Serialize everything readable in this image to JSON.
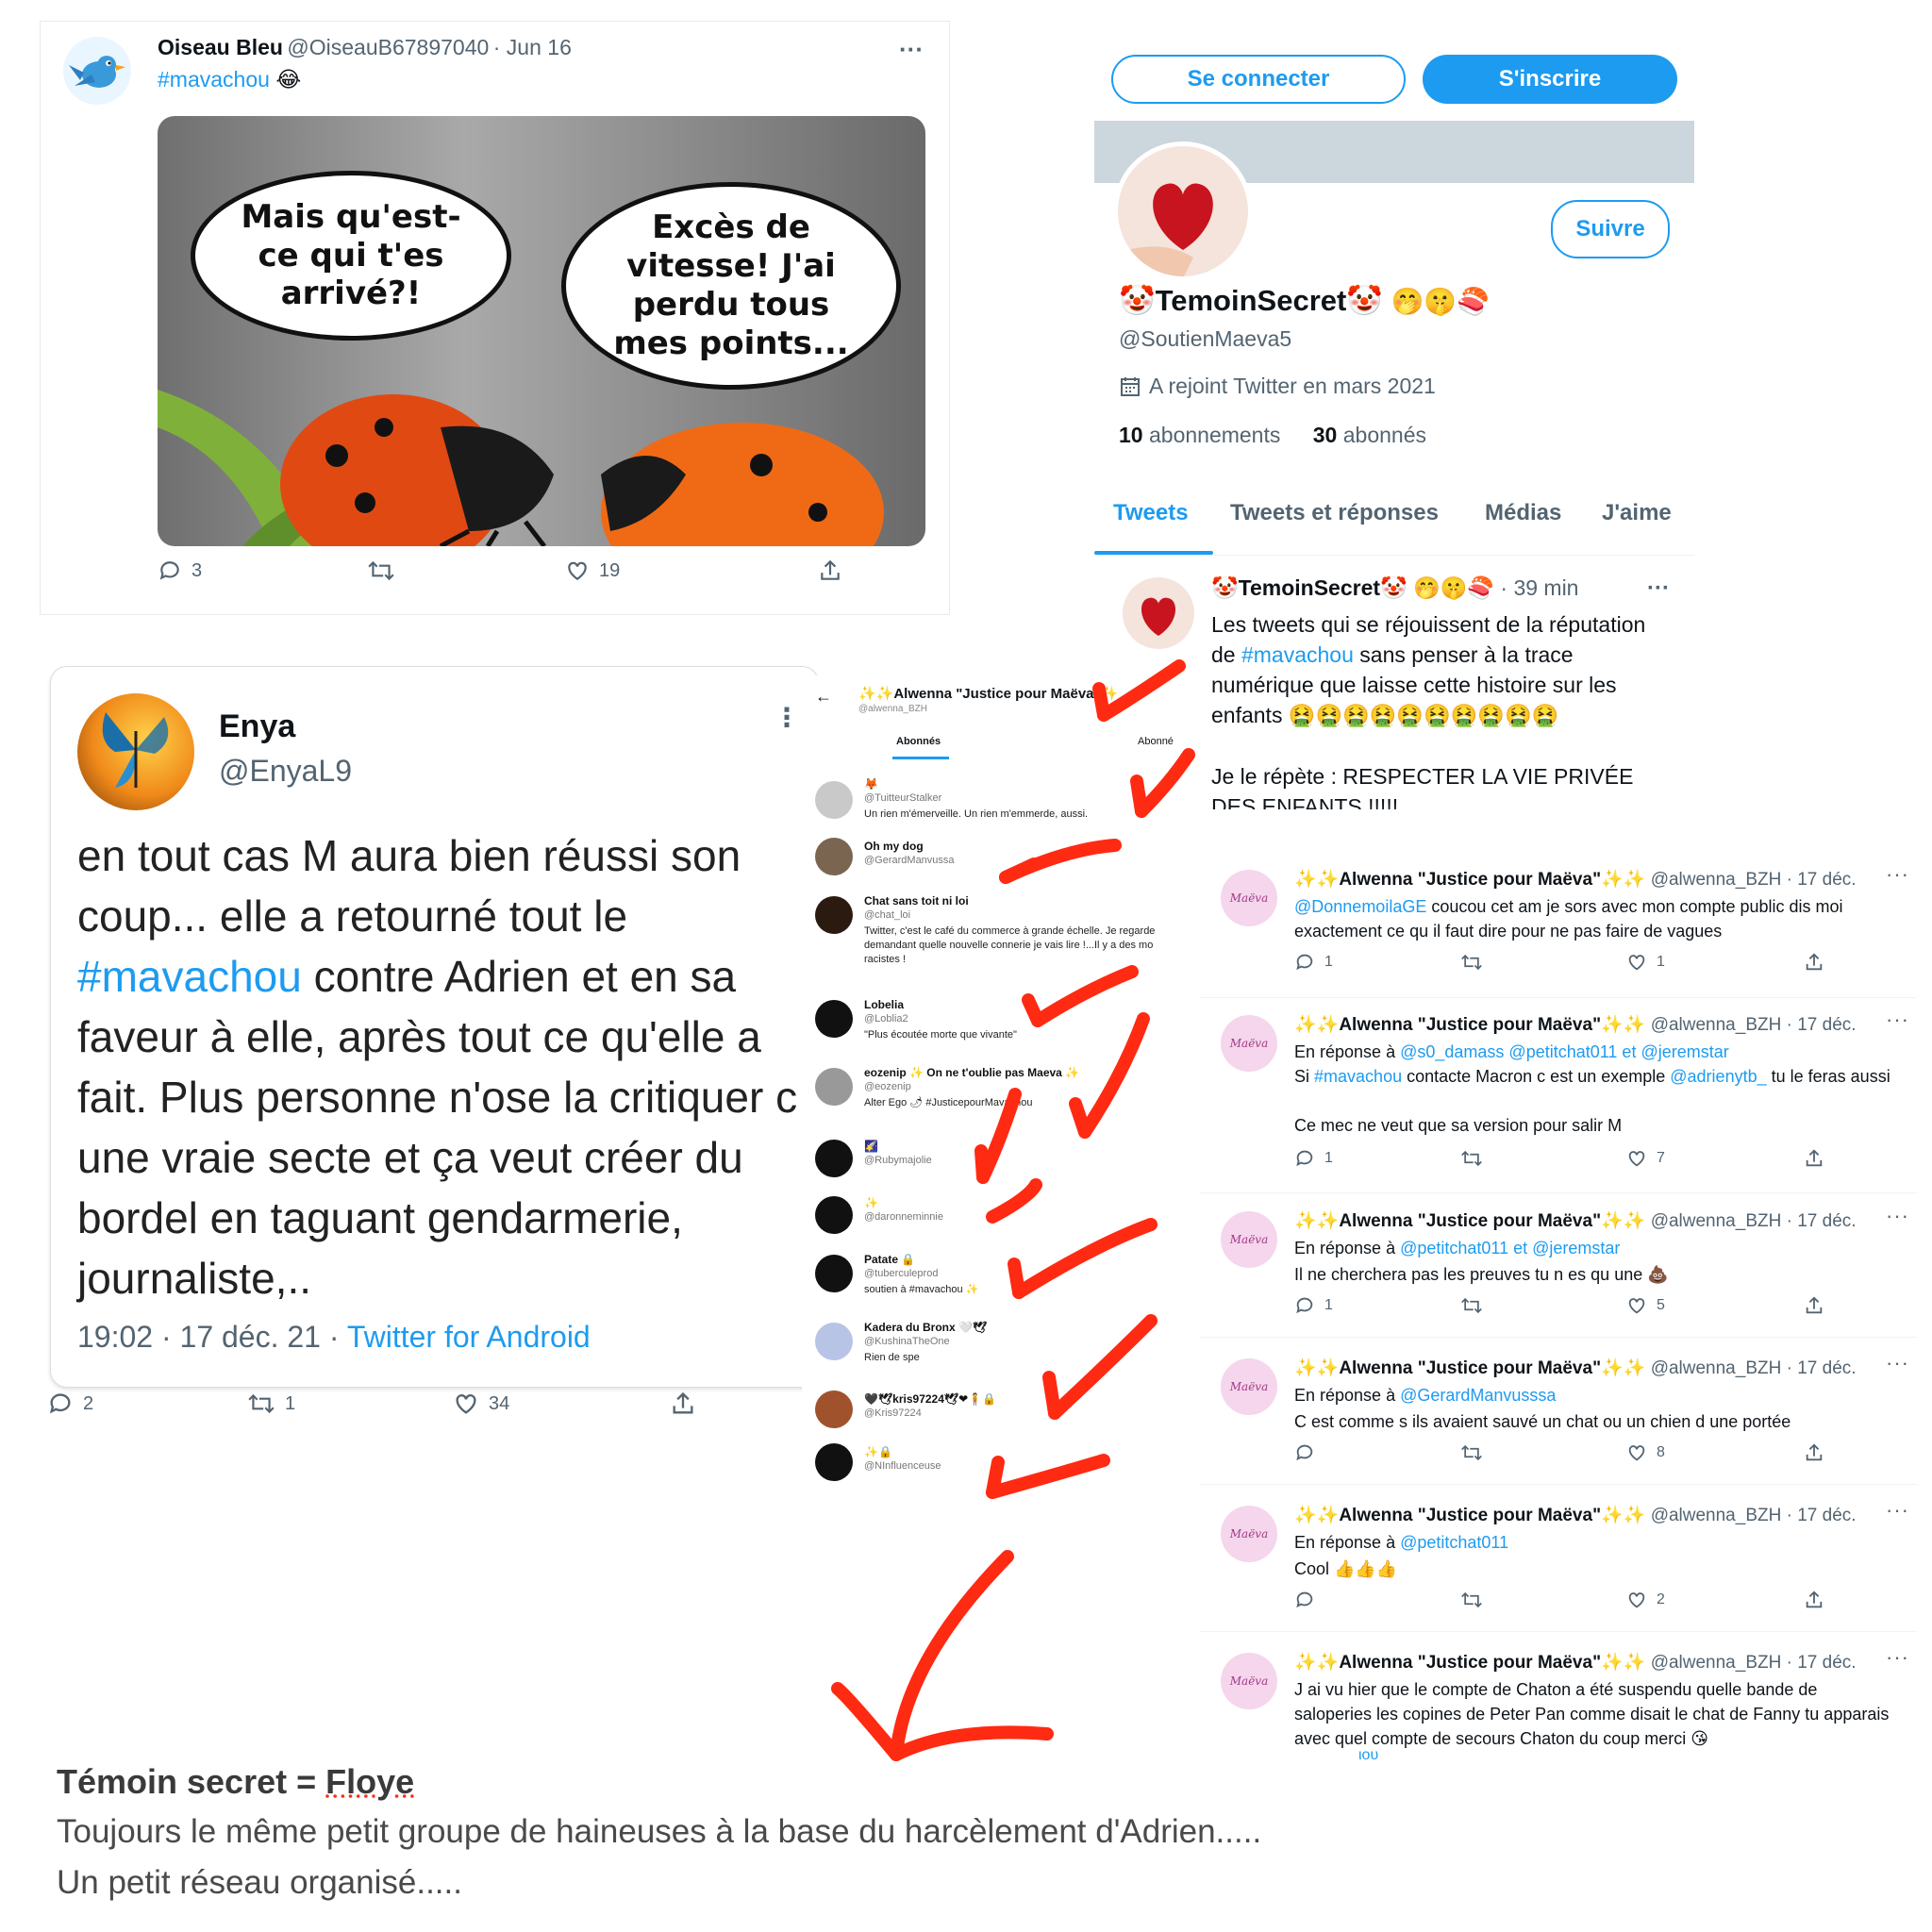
{
  "colors": {
    "twitter_blue": "#1d9bf0",
    "annotation_red": "#ff2a12",
    "text_grey": "#536471"
  },
  "tweet_oiseau": {
    "name": "Oiseau Bleu",
    "handle": "@OiseauB67897040",
    "date": "· Jun 16",
    "hashtag": "#mavachou",
    "emoji": "😂",
    "more": "···",
    "bubble_left": "Mais qu'est-ce qui t'es arrivé?!",
    "bubble_right": "Excès de vitesse! J'ai perdu tous mes points...",
    "replies": "3",
    "likes": "19"
  },
  "profile": {
    "login_button": "Se connecter",
    "signup_button": "S'inscrire",
    "follow_button": "Suivre",
    "display_name": "TemoinSecret",
    "name_emojis": "🤭🤫🍣",
    "handle": "@SoutienMaeva5",
    "joined": "A rejoint Twitter en mars 2021",
    "following_count": "10",
    "following_label": "abonnements",
    "followers_count": "30",
    "followers_label": "abonnés",
    "tabs": [
      "Tweets",
      "Tweets et réponses",
      "Médias",
      "J'aime"
    ],
    "pinned_tweet": {
      "name": "TemoinSecret",
      "emojis": "🤭🤫🍣",
      "time": "· 39 min",
      "more": "···",
      "text_1": "Les tweets qui se réjouissent de la réputation de",
      "hashtag": "#mavachou",
      "text_2": "sans penser à la trace numérique que laisse cette histoire sur les enfants",
      "sick_emojis": "🤮🤮🤮🤮🤮🤮🤮🤮🤮🤮",
      "text_3": "Je le répète  : RESPECTER LA VIE PRIVÉE",
      "text_4": "DES ENFANTS !!!!!"
    }
  },
  "tweet_enya": {
    "name": "Enya",
    "handle": "@EnyaL9",
    "text_1": "en tout cas M aura bien réussi son coup... elle a retourné tout le",
    "hashtag": "#mavachou",
    "text_2": "contre Adrien et en sa faveur à elle, après tout ce qu'elle a fait. Plus personne n'ose la critiquer c une vraie secte et ça veut créer du bordel en taguant gendarmerie, journaliste,..",
    "time": "19:02 · 17 déc. 21 ·",
    "source": "Twitter for Android",
    "replies": "2",
    "retweets": "1",
    "likes": "34"
  },
  "follower_list": {
    "title": "✨✨Alwenna \"Justice pour Maëva\"✨",
    "handle": "@alwenna_BZH",
    "tab_active": "Abonnés",
    "tab_other": "Abonné",
    "items": [
      {
        "name": "🦊",
        "handle": "@TuitteurStalker",
        "bio": "Un rien m'émerveille. Un rien m'emmerde, aussi."
      },
      {
        "name": "Oh my dog",
        "handle": "@GerardManvussa",
        "bio": ""
      },
      {
        "name": "Chat sans toit ni loi",
        "handle": "@chat_loi",
        "bio": "Twitter, c'est le café du commerce à grande échelle. Je regarde demandant quelle nouvelle connerie je vais lire !...Il y a des mo racistes !"
      },
      {
        "name": "Lobelia",
        "handle": "@Loblia2",
        "bio": "\"Plus écoutée morte que vivante\""
      },
      {
        "name": "eozenip ✨ On ne t'oublie pas Maeva ✨",
        "handle": "@eozenip",
        "bio": "Alter Ego 🌶 #JusticepourMavachou"
      },
      {
        "name": "🌠",
        "handle": "@Rubymajolie",
        "bio": ""
      },
      {
        "name": "✨",
        "handle": "@daronneminnie",
        "bio": ""
      },
      {
        "name": "Patate 🔒",
        "handle": "@tuberculeprod",
        "bio": "soutien à #mavachou ✨"
      },
      {
        "name": "Kadera du Bronx 🤍🕊",
        "handle": "@KushinaTheOne",
        "bio": "Rien de spe"
      },
      {
        "name": "🖤🕊kris97224🕊❤🧍🔒",
        "handle": "@Kris97224",
        "bio": ""
      },
      {
        "name": "✨🔒",
        "handle": "@NInfluenceuse",
        "bio": ""
      }
    ]
  },
  "alwenna_tweets": {
    "name": "✨✨Alwenna \"Justice pour Maëva\"✨✨",
    "handle": "@alwenna_BZH",
    "date": "· 17 déc.",
    "avatar_text": "Maëva",
    "items": [
      {
        "reply_to": "",
        "mention": "@DonnemoilaGE",
        "text": "coucou cet am je sors avec mon compte public dis moi exactement ce qu il faut dire pour ne pas faire de vagues",
        "replies": "1",
        "likes": "1"
      },
      {
        "reply_to": "En réponse à",
        "mention": "@s0_damass @petitchat011  et  @jeremstar",
        "text_a": "Si",
        "hashtag": "#mavachou",
        "text_b": "contacte Macron c est un exemple",
        "mention2": "@adrienytb_",
        "text_c": "tu le feras aussi",
        "text": "Ce mec ne veut que sa version pour salir M",
        "replies": "1",
        "likes": "7"
      },
      {
        "reply_to": "En réponse à",
        "mention": "@petitchat011  et  @jeremstar",
        "text": "Il ne cherchera pas les preuves tu n es qu une 💩",
        "replies": "1",
        "likes": "5"
      },
      {
        "reply_to": "En réponse à",
        "mention": "@GerardManvusssa",
        "text": "C est comme s ils avaient sauvé  un chat ou un chien d une portée",
        "replies": "",
        "likes": "8"
      },
      {
        "reply_to": "En réponse à",
        "mention": "@petitchat011",
        "text": "Cool 👍👍👍",
        "replies": "",
        "likes": "2"
      },
      {
        "reply_to": "",
        "mention": "",
        "text": "J ai vu hier que  le compte de Chaton a été suspendu quelle bande de saloperies les copines de Peter Pan comme disait le chat de Fanny  tu apparais avec quel compte de secours Chaton du coup merci 😘",
        "replies": "",
        "likes": ""
      }
    ],
    "cut_text": "ιου"
  },
  "caption": {
    "title_a": "Témoin secret = ",
    "title_b": "Floye",
    "line1": "Toujours le même petit groupe de haineuses à la base du harcèlement d'Adrien.....",
    "line2": "Un petit réseau organisé....."
  }
}
